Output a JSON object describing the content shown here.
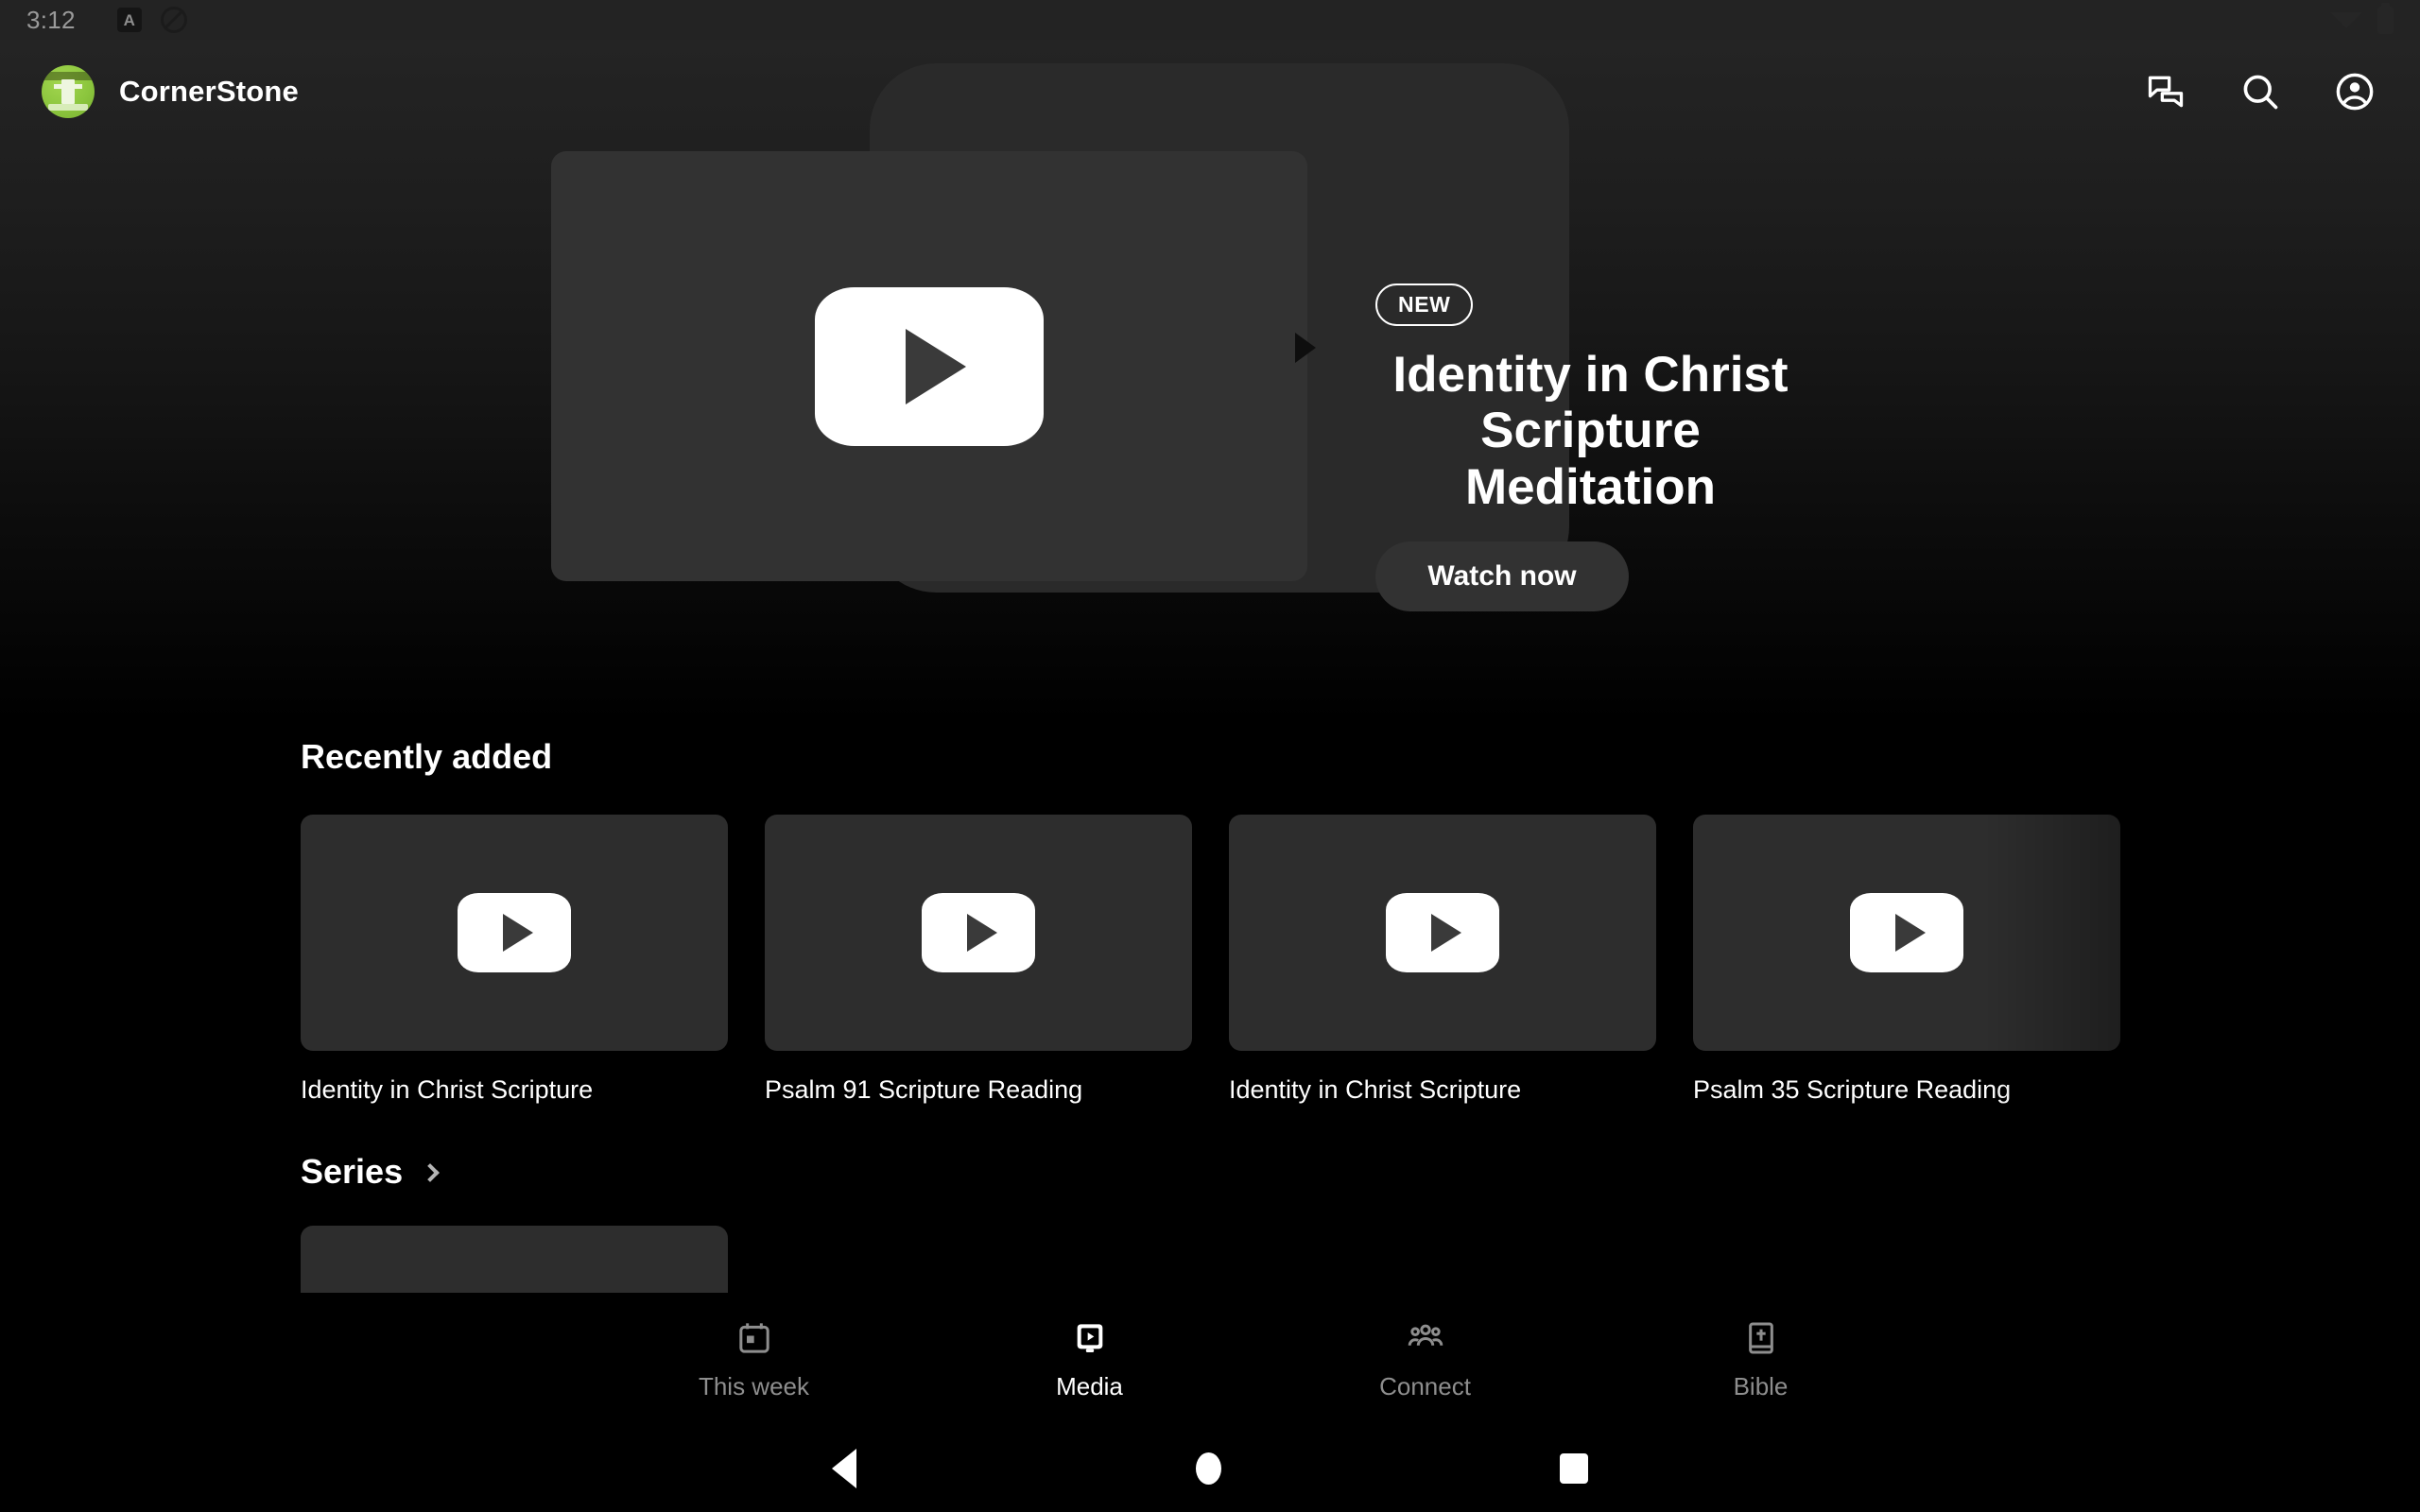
{
  "status_bar": {
    "time": "3:12",
    "icons_left": [
      "font-size-icon",
      "do-not-disturb-icon"
    ],
    "icons_right": [
      "wifi-icon",
      "battery-icon"
    ]
  },
  "header": {
    "app_name": "CornerStone",
    "logo_name": "cornerstone-logo",
    "actions": [
      {
        "name": "messages-icon",
        "label": "Messages"
      },
      {
        "name": "search-icon",
        "label": "Search"
      },
      {
        "name": "account-icon",
        "label": "Account"
      }
    ]
  },
  "hero": {
    "badge": "NEW",
    "title": "Identity in Christ\nScripture Meditation",
    "cta_label": "Watch now",
    "thumbnail_icon": "youtube-play-icon"
  },
  "recently_added": {
    "heading": "Recently added",
    "items": [
      {
        "title": "Identity in Christ Scripture"
      },
      {
        "title": "Psalm 91 Scripture Reading"
      },
      {
        "title": "Identity in Christ Scripture"
      },
      {
        "title": "Psalm 35 Scripture Reading"
      }
    ]
  },
  "series": {
    "heading": "Series",
    "items": [
      {
        "title": ""
      }
    ]
  },
  "bottom_nav": {
    "items": [
      {
        "label": "This week",
        "icon": "calendar-icon",
        "active": false
      },
      {
        "label": "Media",
        "icon": "media-play-icon",
        "active": true
      },
      {
        "label": "Connect",
        "icon": "people-group-icon",
        "active": false
      },
      {
        "label": "Bible",
        "icon": "bible-book-icon",
        "active": false
      }
    ]
  },
  "system_nav": {
    "back": "back-button",
    "home": "home-button",
    "recents": "recents-button"
  },
  "colors": {
    "background": "#000000",
    "surface": "#2d2d2d",
    "accent_green": "#8cc63e",
    "text_primary": "#ffffff",
    "text_muted": "#8e8e8e"
  }
}
